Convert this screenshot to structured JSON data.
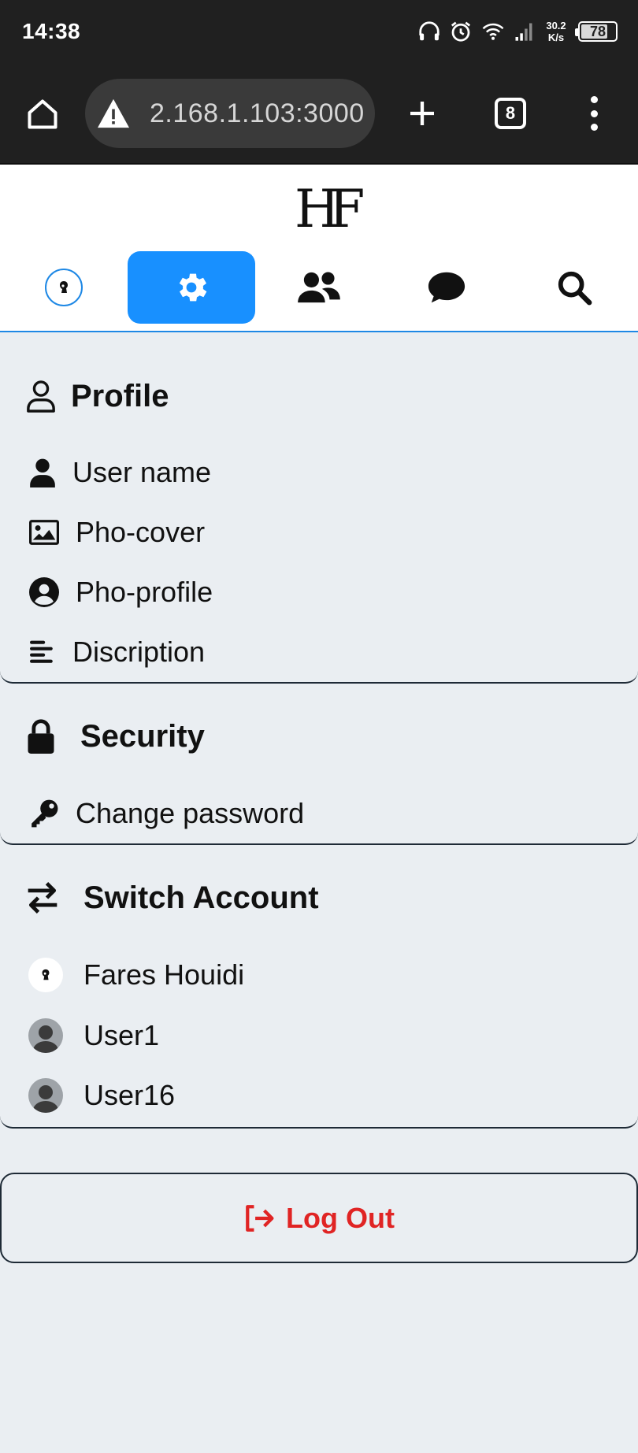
{
  "status_bar": {
    "time": "14:38",
    "net_speed_value": "30.2",
    "net_speed_unit": "K/s",
    "battery_level": "78",
    "icons": [
      "headphones-icon",
      "alarm-icon",
      "wifi-icon",
      "signal-icon",
      "battery-icon"
    ]
  },
  "browser": {
    "url": "2.168.1.103:3000",
    "tab_count": "8",
    "icons": [
      "home-icon",
      "warning-icon",
      "plus-icon",
      "tabs-icon",
      "more-vert-icon"
    ]
  },
  "app": {
    "logo": "HF",
    "nav": [
      {
        "name": "profile-avatar",
        "active": false
      },
      {
        "name": "settings",
        "active": true
      },
      {
        "name": "friends",
        "active": false
      },
      {
        "name": "messages",
        "active": false
      },
      {
        "name": "search",
        "active": false
      }
    ],
    "accent_color": "#1890ff"
  },
  "sections": {
    "profile": {
      "title": "Profile",
      "items": [
        {
          "label": "User name",
          "icon": "user-icon"
        },
        {
          "label": "Pho-cover",
          "icon": "image-icon"
        },
        {
          "label": "Pho-profile",
          "icon": "user-circle-icon"
        },
        {
          "label": "Discription",
          "icon": "align-left-icon"
        }
      ]
    },
    "security": {
      "title": "Security",
      "items": [
        {
          "label": "Change password",
          "icon": "key-icon"
        }
      ]
    },
    "switch_account": {
      "title": "Switch Account",
      "items": [
        {
          "label": "Fares Houidi",
          "icon": "avatar"
        },
        {
          "label": "User1",
          "icon": "default-avatar"
        },
        {
          "label": "User16",
          "icon": "default-avatar"
        }
      ]
    }
  },
  "logout": {
    "label": "Log Out",
    "color": "#e02424"
  }
}
